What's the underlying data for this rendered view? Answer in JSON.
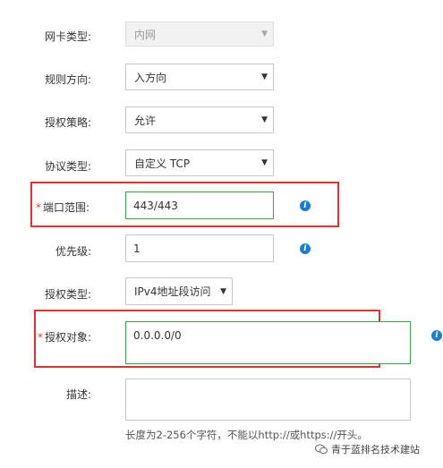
{
  "form": {
    "nic_type": {
      "label": "网卡类型:",
      "value": "内网"
    },
    "direction": {
      "label": "规则方向:",
      "value": "入方向"
    },
    "policy": {
      "label": "授权策略:",
      "value": "允许"
    },
    "protocol": {
      "label": "协议类型:",
      "value": "自定义 TCP"
    },
    "port_range": {
      "required_mark": "*",
      "label": "端口范围:",
      "value": "443/443"
    },
    "priority": {
      "label": "优先级:",
      "value": "1"
    },
    "auth_type": {
      "label": "授权类型:",
      "value": "IPv4地址段访问"
    },
    "auth_target": {
      "required_mark": "*",
      "label": "授权对象:",
      "value": "0.0.0.0/0"
    },
    "description": {
      "label": "描述:",
      "value": "",
      "hint": "长度为2-256个字符，不能以http://或https://开头。"
    }
  },
  "icons": {
    "info": "i",
    "dropdown": "▼"
  },
  "colors": {
    "highlight_red": "#e0302f",
    "focus_green": "#3aa34a",
    "info_blue": "#1a7fd1"
  },
  "watermark": {
    "text": "青于蓝排名技术建站"
  }
}
